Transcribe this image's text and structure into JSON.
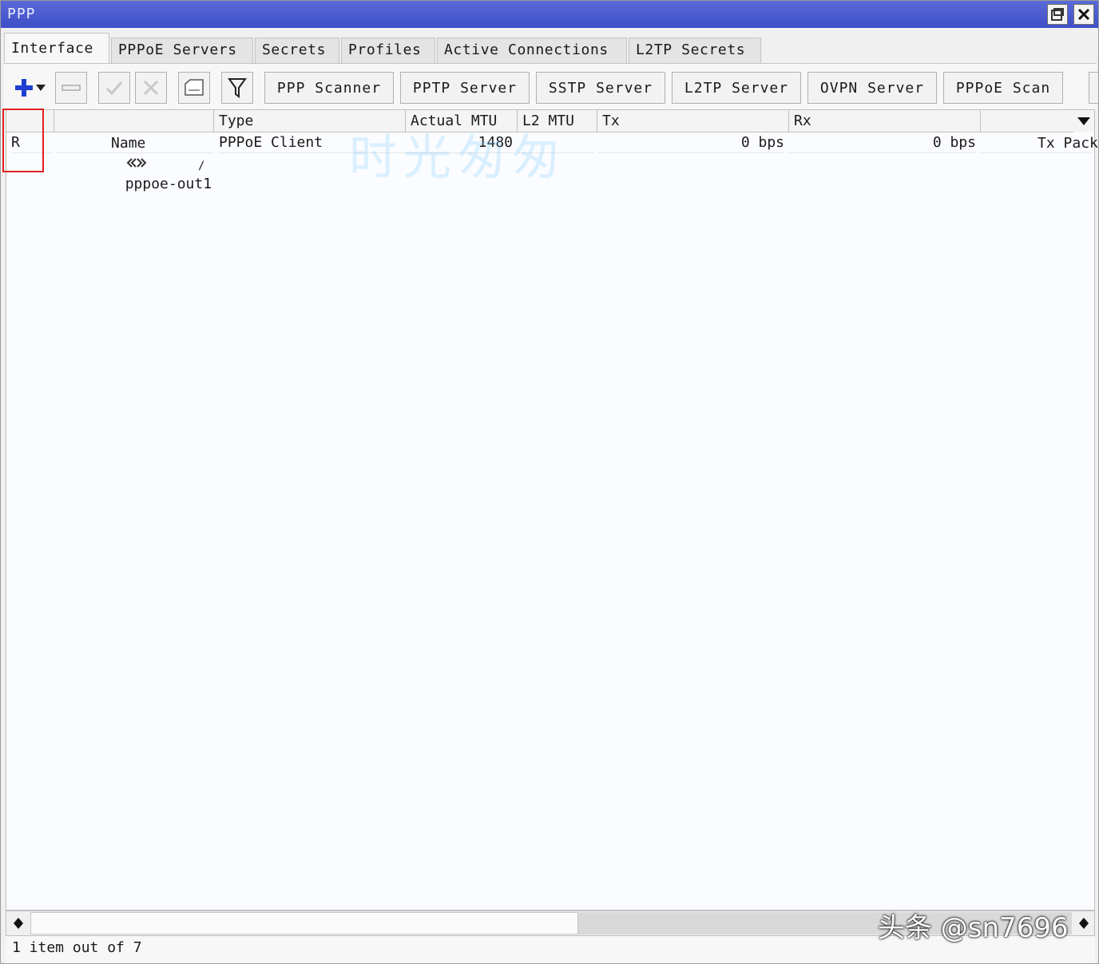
{
  "window": {
    "title": "PPP"
  },
  "tabs": [
    "Interface",
    "PPPoE Servers",
    "Secrets",
    "Profiles",
    "Active Connections",
    "L2TP Secrets"
  ],
  "toolbar": {
    "buttons": [
      "PPP Scanner",
      "PPTP Server",
      "SSTP Server",
      "L2TP Server",
      "OVPN Server",
      "PPPoE Scan"
    ]
  },
  "table": {
    "columns": [
      "",
      "Name",
      "Type",
      "Actual MTU",
      "L2 MTU",
      "Tx",
      "Rx",
      "Tx Packet"
    ],
    "sort_marker": "/",
    "rows": [
      {
        "flag": "R",
        "name": "pppoe-out1",
        "type": "PPPoE Client",
        "actual_mtu": "1480",
        "l2_mtu": "",
        "tx": "0 bps",
        "rx": "0 bps",
        "tx_packet": ""
      }
    ]
  },
  "status": {
    "text": "1 item out of 7"
  },
  "overlays": {
    "watermark_center": "时光匆匆",
    "watermark_corner": "头条 @sn7696"
  },
  "colors": {
    "titlebar": "#4656cc",
    "highlight": "#e02020",
    "add_icon": "#1f3fd0"
  }
}
